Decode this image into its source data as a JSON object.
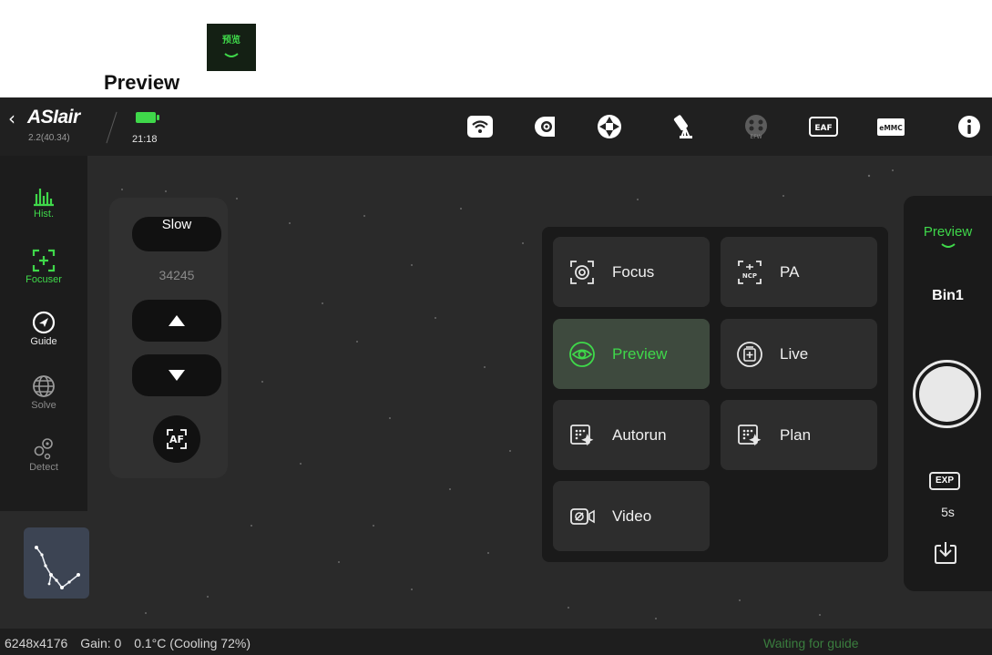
{
  "header": {
    "title": "Preview",
    "tab_label": "预览"
  },
  "topbar": {
    "app_name": "ASIair",
    "version": "2.2(40.34)",
    "time": "21:18",
    "battery_color": "#3fd84a",
    "icons": [
      "wifi-icon",
      "camera-icon",
      "guide-scope-icon",
      "mount-icon",
      "filter-wheel-icon",
      "eaf-icon",
      "emmc-icon",
      "info-icon"
    ],
    "efw_label": "EFW",
    "eaf_label": "EAF",
    "emmc_label": "eMMC"
  },
  "sidebar": {
    "items": [
      {
        "label": "Hist.",
        "icon": "histogram-icon",
        "active": true
      },
      {
        "label": "Focuser",
        "icon": "focuser-icon",
        "active": true
      },
      {
        "label": "Guide",
        "icon": "guide-icon",
        "active": false
      },
      {
        "label": "Solve",
        "icon": "globe-icon",
        "active": false
      },
      {
        "label": "Detect",
        "icon": "detect-icon",
        "active": false
      }
    ]
  },
  "focuser": {
    "speed_label": "Slow",
    "steps": "34245",
    "af_label": "AF"
  },
  "modes": [
    {
      "label": "Focus",
      "icon": "focus-icon",
      "active": false
    },
    {
      "label": "PA",
      "icon": "polar-align-icon",
      "active": false,
      "badge": "NCP"
    },
    {
      "label": "Preview",
      "icon": "eye-icon",
      "active": true
    },
    {
      "label": "Live",
      "icon": "live-stack-icon",
      "active": false
    },
    {
      "label": "Autorun",
      "icon": "autorun-icon",
      "active": false
    },
    {
      "label": "Plan",
      "icon": "plan-icon",
      "active": false
    },
    {
      "label": "Video",
      "icon": "video-icon",
      "active": false
    }
  ],
  "right_panel": {
    "mode_label": "Preview",
    "bin_label": "Bin1",
    "exp_tag": "EXP",
    "exposure": "5s"
  },
  "status": {
    "resolution": "6248x4176",
    "gain": "Gain: 0",
    "temperature": "0.1°C (Cooling 72%)",
    "guide_status": "Waiting for guide"
  },
  "colors": {
    "accent": "#3fd84a",
    "guide_status": "#3a7d3e"
  }
}
